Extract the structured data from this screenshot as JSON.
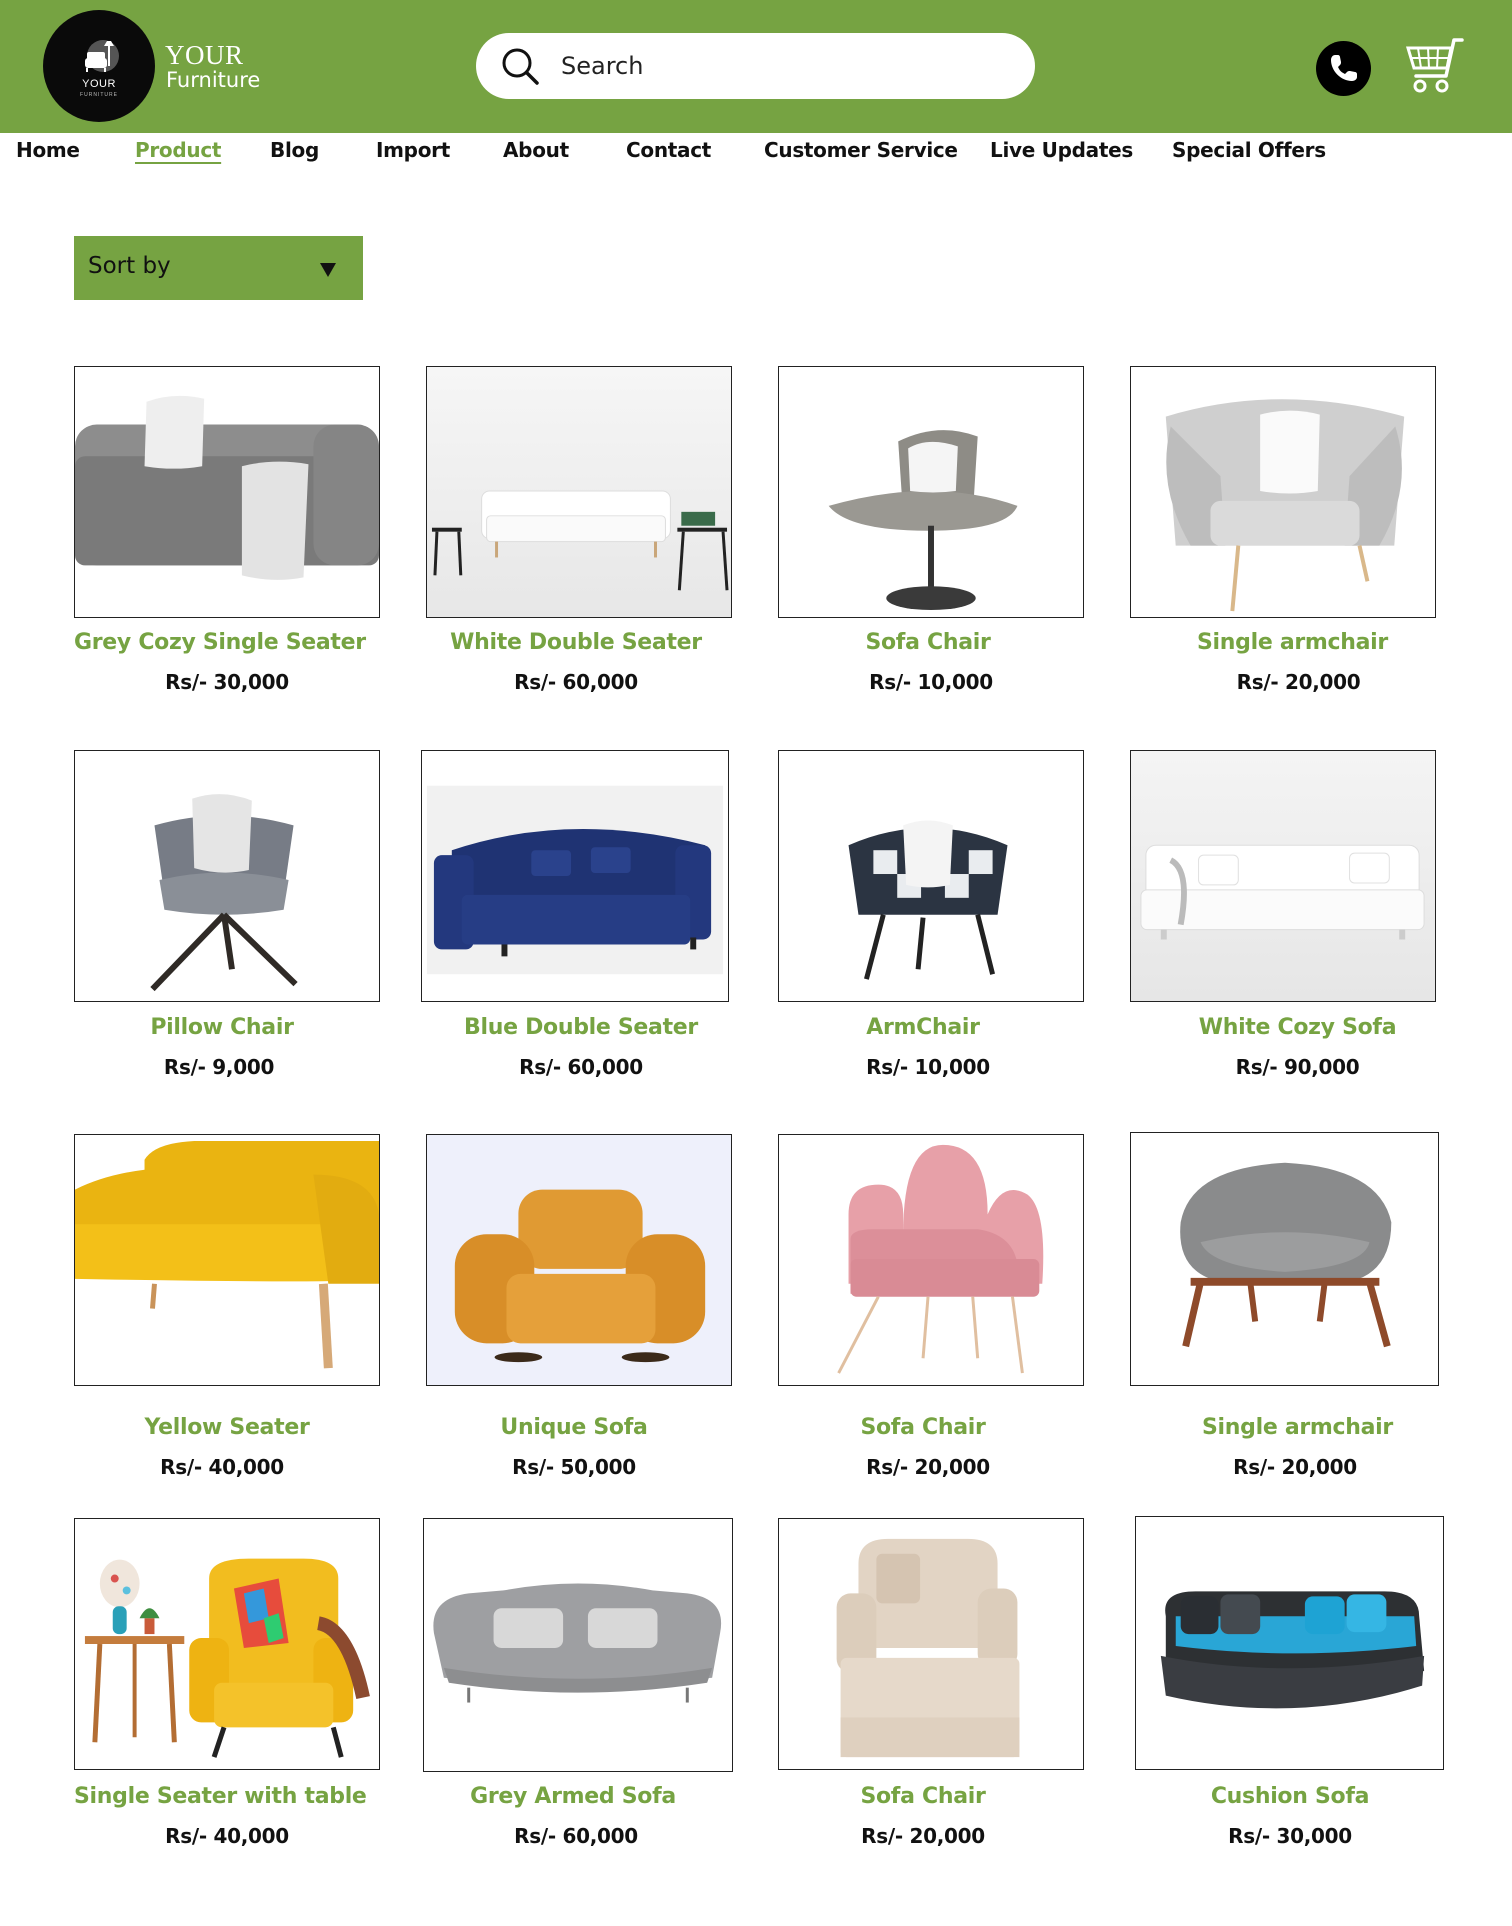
{
  "brand": {
    "line1": "YOUR",
    "line2": "Furniture",
    "logo_text": "YOUR",
    "logo_sub": "FURNITURE"
  },
  "search": {
    "placeholder": "Search"
  },
  "nav": {
    "items": [
      {
        "label": "Home",
        "active": false
      },
      {
        "label": "Product",
        "active": true
      },
      {
        "label": "Blog",
        "active": false
      },
      {
        "label": "Import",
        "active": false
      },
      {
        "label": "About",
        "active": false
      },
      {
        "label": "Contact",
        "active": false
      },
      {
        "label": "Customer Service",
        "active": false
      },
      {
        "label": "Live Updates",
        "active": false
      },
      {
        "label": "Special Offers",
        "active": false
      }
    ]
  },
  "sort": {
    "label": "Sort by"
  },
  "icons": {
    "phone": "phone-icon",
    "cart": "cart-icon",
    "search": "search-icon",
    "sort": "triangle-down-icon"
  },
  "colors": {
    "brand_green": "#76a342",
    "header_bg": "#76a342",
    "text": "#111111"
  },
  "products": [
    {
      "name": "Grey Cozy Single Seater",
      "price": "Rs/- 30,000"
    },
    {
      "name": "White Double Seater",
      "price": "Rs/- 60,000"
    },
    {
      "name": "Sofa Chair",
      "price": "Rs/- 10,000"
    },
    {
      "name": "Single armchair",
      "price": "Rs/- 20,000"
    },
    {
      "name": "Pillow Chair",
      "price": "Rs/- 9,000"
    },
    {
      "name": "Blue Double Seater",
      "price": "Rs/- 60,000"
    },
    {
      "name": "ArmChair",
      "price": "Rs/- 10,000"
    },
    {
      "name": "White Cozy Sofa",
      "price": "Rs/- 90,000"
    },
    {
      "name": "Yellow Seater",
      "price": "Rs/- 40,000"
    },
    {
      "name": "Unique Sofa",
      "price": "Rs/- 50,000"
    },
    {
      "name": "Sofa Chair",
      "price": "Rs/- 20,000"
    },
    {
      "name": "Single armchair",
      "price": "Rs/- 20,000"
    },
    {
      "name": "Single Seater with table",
      "price": "Rs/- 40,000"
    },
    {
      "name": "Grey Armed Sofa",
      "price": "Rs/- 60,000"
    },
    {
      "name": "Sofa Chair",
      "price": "Rs/- 20,000"
    },
    {
      "name": "Cushion Sofa",
      "price": "Rs/- 30,000"
    }
  ]
}
